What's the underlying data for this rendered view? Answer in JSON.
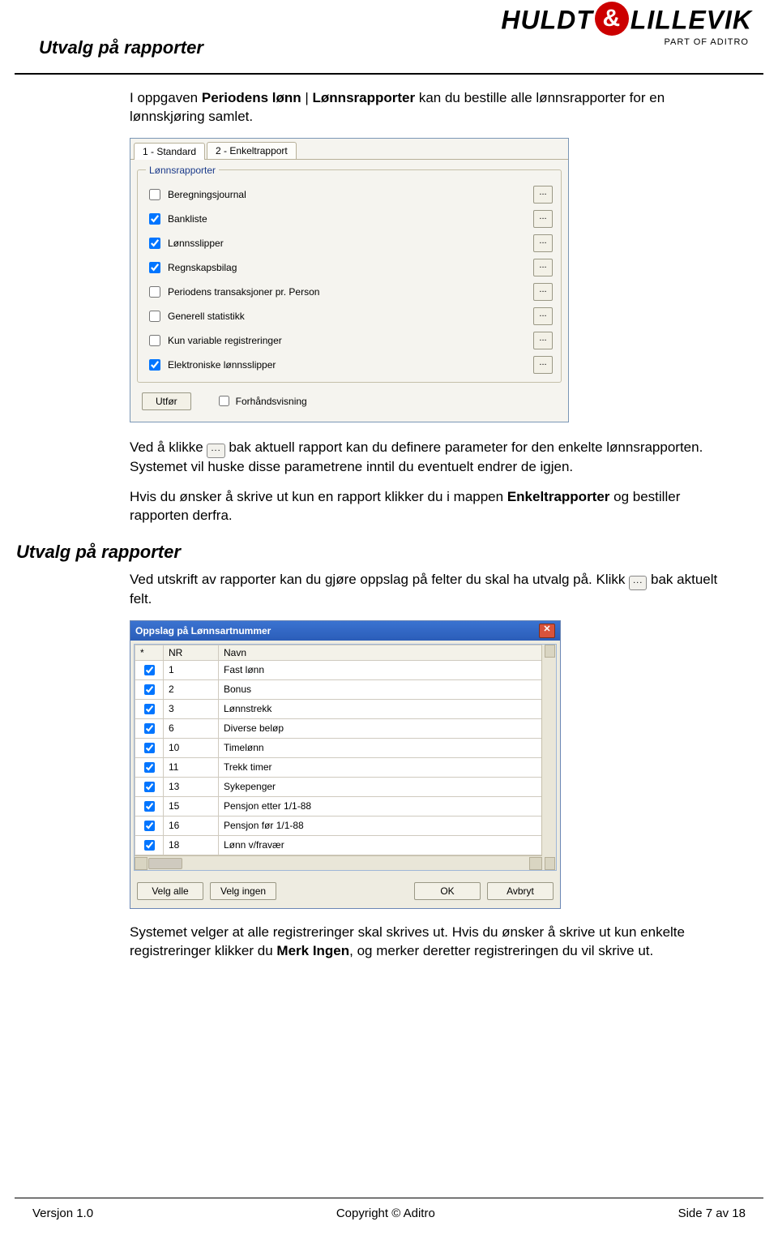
{
  "page_header_title": "Utvalg på rapporter",
  "logo": {
    "left": "HULDT",
    "amp": "&",
    "right": "LILLEVIK",
    "sub": "PART OF ADITRO"
  },
  "p1_pre": "I oppgaven ",
  "p1_b1": "Periodens lønn",
  "p1_sep": " | ",
  "p1_b2": "Lønnsrapporter",
  "p1_post": " kan du bestille alle lønnsrapporter for en lønnskjøring samlet.",
  "p2_pre": "Ved å klikke ",
  "p2_post": " bak aktuell rapport kan du definere parameter for den enkelte lønnsrapporten. Systemet vil huske disse parametrene inntil du eventuelt endrer de igjen.",
  "p3_pre": "Hvis du ønsker å skrive ut kun en rapport klikker du i mappen ",
  "p3_b": "Enkeltrapporter",
  "p3_post": " og bestiller rapporten derfra.",
  "section2_title": "Utvalg på rapporter",
  "p4_pre": "Ved utskrift av rapporter kan du gjøre oppslag på felter du skal ha utvalg på. Klikk ",
  "p4_post": " bak aktuelt felt.",
  "p5_pre": "Systemet velger at alle registreringer skal skrives ut. Hvis du ønsker å skrive ut kun enkelte registreringer klikker du ",
  "p5_b": "Merk Ingen",
  "p5_post": ", og merker deretter registreringen du vil skrive ut.",
  "dots_glyph": "...",
  "ss1": {
    "tab1": "1 - Standard",
    "tab2": "2 - Enkeltrapport",
    "legend": "Lønnsrapporter",
    "rows": [
      {
        "label": "Beregningsjournal",
        "checked": false
      },
      {
        "label": "Bankliste",
        "checked": true
      },
      {
        "label": "Lønnsslipper",
        "checked": true
      },
      {
        "label": "Regnskapsbilag",
        "checked": true
      },
      {
        "label": "Periodens transaksjoner pr. Person",
        "checked": false
      },
      {
        "label": "Generell statistikk",
        "checked": false
      },
      {
        "label": "Kun variable registreringer",
        "checked": false
      },
      {
        "label": "Elektroniske lønnsslipper",
        "checked": true
      }
    ],
    "execute_btn": "Utfør",
    "preview_label": "Forhåndsvisning"
  },
  "ss2": {
    "title": "Oppslag på Lønnsartnummer",
    "col_star": "*",
    "col_nr": "NR",
    "col_name": "Navn",
    "rows": [
      {
        "nr": "1",
        "name": "Fast lønn"
      },
      {
        "nr": "2",
        "name": "Bonus"
      },
      {
        "nr": "3",
        "name": "Lønnstrekk"
      },
      {
        "nr": "6",
        "name": "Diverse beløp"
      },
      {
        "nr": "10",
        "name": "Timelønn"
      },
      {
        "nr": "11",
        "name": "Trekk timer"
      },
      {
        "nr": "13",
        "name": "Sykepenger"
      },
      {
        "nr": "15",
        "name": "Pensjon etter 1/1-88"
      },
      {
        "nr": "16",
        "name": "Pensjon før 1/1-88"
      },
      {
        "nr": "18",
        "name": "Lønn v/fravær"
      }
    ],
    "btn_all": "Velg alle",
    "btn_none": "Velg ingen",
    "btn_ok": "OK",
    "btn_cancel": "Avbryt"
  },
  "footer": {
    "left": "Versjon 1.0",
    "center": "Copyright © Aditro",
    "right": "Side 7 av 18"
  }
}
